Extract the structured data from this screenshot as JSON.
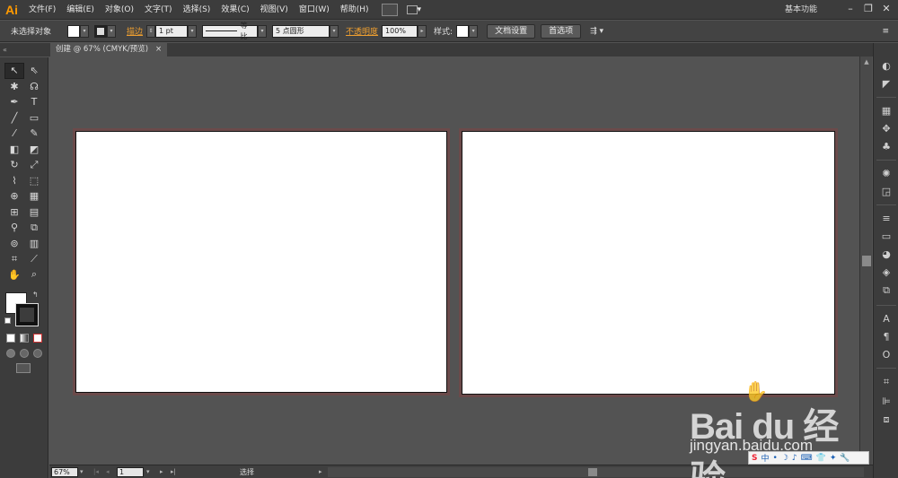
{
  "app": {
    "logo_text": "Ai",
    "menu": [
      "文件(F)",
      "编辑(E)",
      "对象(O)",
      "文字(T)",
      "选择(S)",
      "效果(C)",
      "视图(V)",
      "窗口(W)",
      "帮助(H)"
    ],
    "workspace_label": "基本功能",
    "window_buttons": [
      "–",
      "❐",
      "✕"
    ]
  },
  "control_bar": {
    "selection_status": "未选择对象",
    "stroke_label": "描边",
    "stroke_weight": "1 pt",
    "stroke_profile_label": "等比",
    "brush_label": "5 点圆形",
    "opacity_label": "不透明度",
    "opacity_value": "100%",
    "style_label": "样式:",
    "doc_setup_button": "文档设置",
    "preferences_button": "首选项"
  },
  "tabs": {
    "document_tab": "创建 @ 67% (CMYK/预览)",
    "close_glyph": "×"
  },
  "status_bar": {
    "zoom": "67%",
    "artboard_number": "1",
    "tool_status": "选择"
  },
  "watermark": {
    "logo": "Bai du 经验",
    "url": "jingyan.baidu.com"
  },
  "ime": {
    "items": [
      "S",
      "中",
      "•",
      "☽",
      "♪",
      "⌨",
      "👕",
      "✦",
      "🔧"
    ]
  },
  "colors": {
    "accent_orange": "#ff9a00",
    "panel_bg": "#3c3c3c",
    "canvas_bg": "#535353",
    "artboard_border": "#6b4a4a"
  }
}
